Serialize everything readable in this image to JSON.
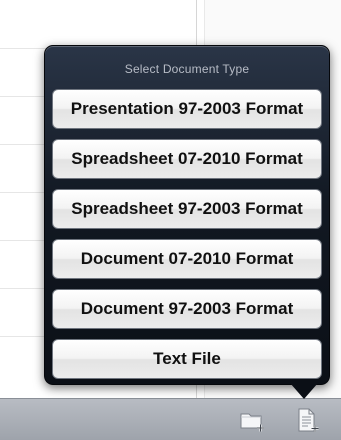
{
  "popover": {
    "title": "Select Document Type",
    "options": [
      {
        "label": "Presentation 97-2003 Format"
      },
      {
        "label": "Spreadsheet 07-2010 Format"
      },
      {
        "label": "Spreadsheet 97-2003 Format"
      },
      {
        "label": "Document 07-2010 Format"
      },
      {
        "label": "Document 97-2003 Format"
      },
      {
        "label": "Text File"
      }
    ]
  },
  "toolbar": {
    "buttons": [
      {
        "icon": "new-folder-icon"
      },
      {
        "icon": "new-document-icon"
      }
    ]
  }
}
